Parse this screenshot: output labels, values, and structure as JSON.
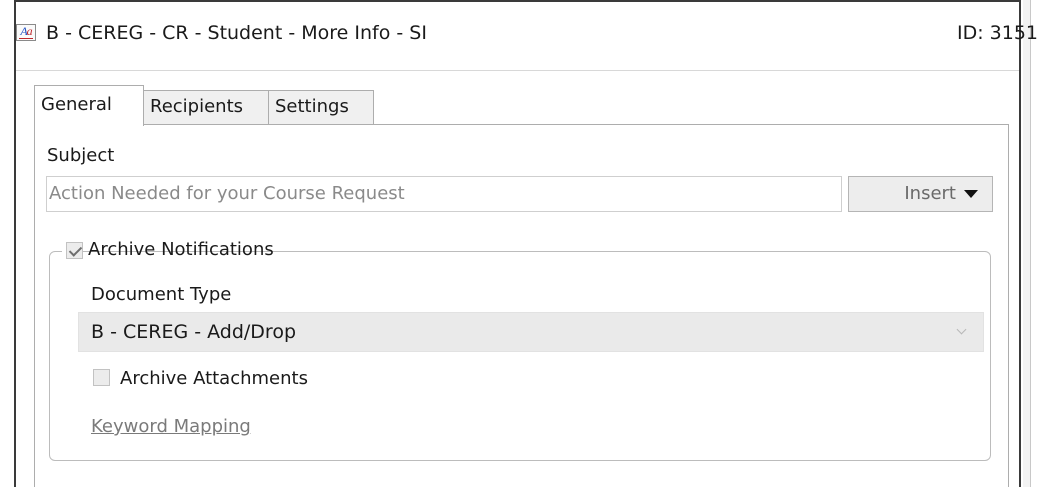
{
  "header": {
    "title": "B - CEREG - CR - Student - More Info - SI",
    "id_label": "ID: 3151",
    "icon": "text-format-icon"
  },
  "tabs": [
    {
      "label": "General",
      "active": true
    },
    {
      "label": "Recipients",
      "active": false
    },
    {
      "label": "Settings",
      "active": false
    }
  ],
  "subject": {
    "label": "Subject",
    "value": "Action Needed for your Course Request",
    "insert_label": "Insert"
  },
  "archive": {
    "label": "Archive Notifications",
    "checked": true,
    "document_type_label": "Document Type",
    "document_type_value": "B - CEREG - Add/Drop",
    "attachments_label": "Archive Attachments",
    "attachments_checked": false,
    "keyword_mapping_label": "Keyword Mapping"
  }
}
